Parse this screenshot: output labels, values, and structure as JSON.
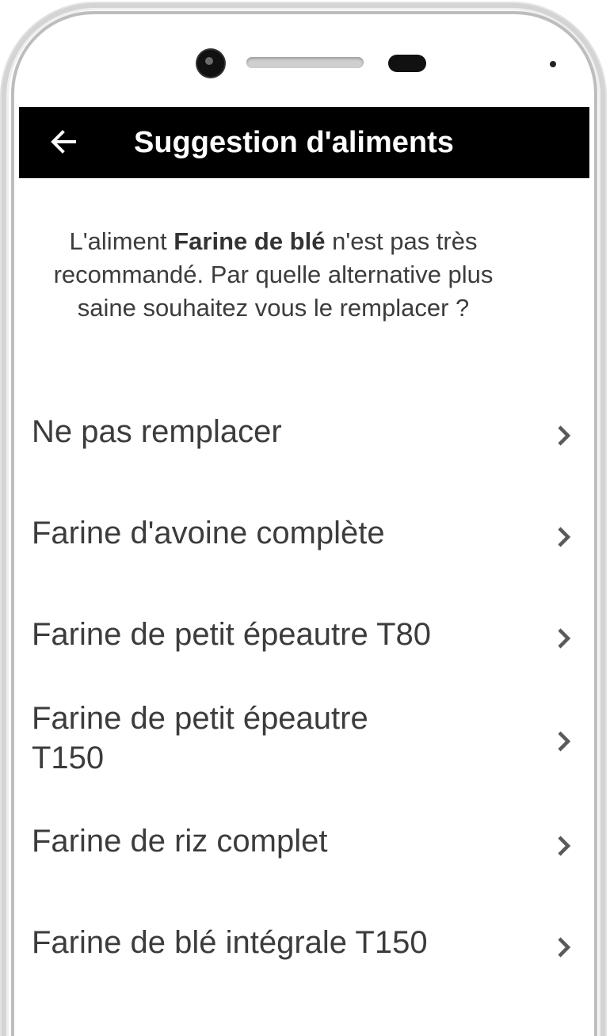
{
  "app_bar": {
    "title": "Suggestion d'aliments",
    "back_icon": "arrow-left-icon"
  },
  "intro": {
    "prefix": "L'aliment ",
    "food": "Farine de blé",
    "suffix": " n'est pas très recommandé. Par quelle alternative plus saine souhaitez vous le remplacer ?"
  },
  "options": [
    {
      "label": "Ne pas remplacer",
      "icon": "chevron-right-icon"
    },
    {
      "label": "Farine d'avoine complète",
      "icon": "chevron-right-icon"
    },
    {
      "label": "Farine de petit épeautre T80",
      "icon": "chevron-right-icon"
    },
    {
      "label": "Farine de petit épeautre T150",
      "icon": "chevron-right-icon"
    },
    {
      "label": "Farine de riz complet",
      "icon": "chevron-right-icon"
    },
    {
      "label": "Farine de blé intégrale T150",
      "icon": "chevron-right-icon"
    }
  ],
  "colors": {
    "app_bar": "#000000",
    "app_bar_text": "#ffffff",
    "text": "#3c3c3c",
    "chevron": "#5a5a5a"
  }
}
